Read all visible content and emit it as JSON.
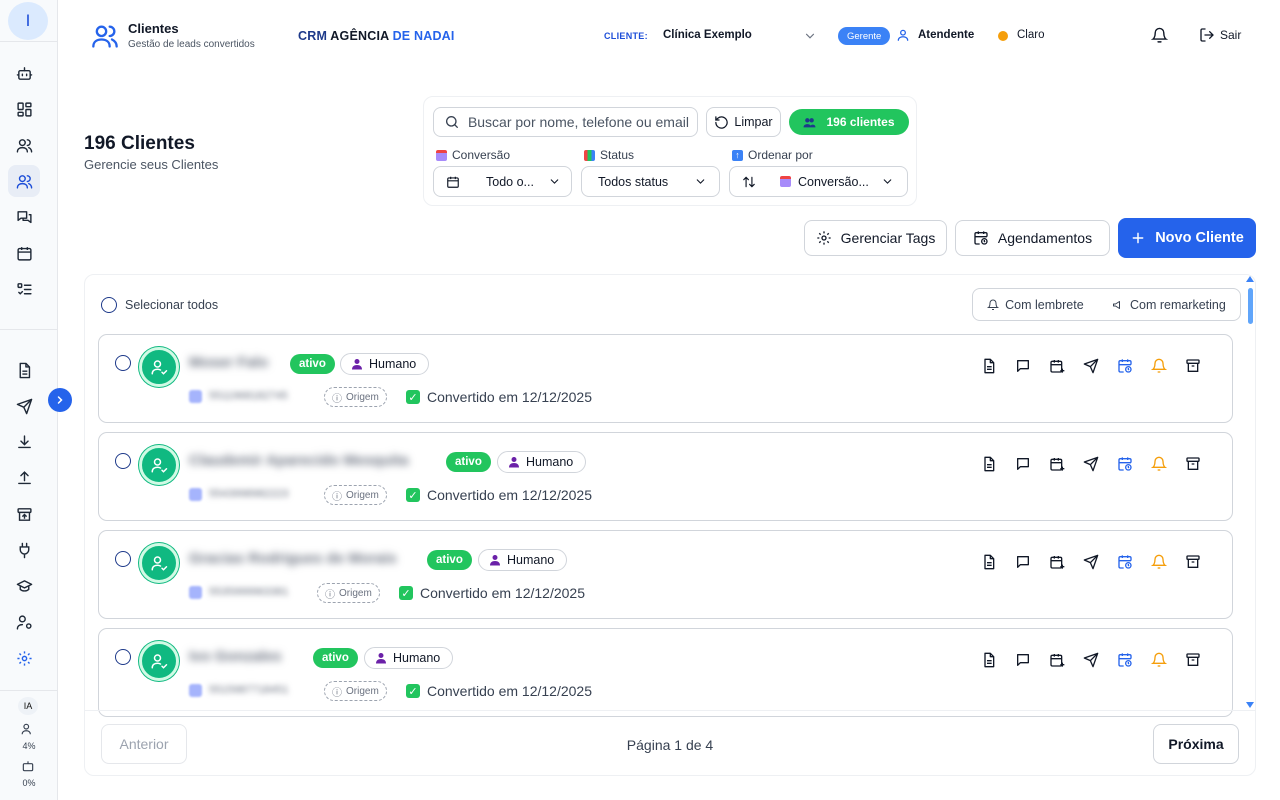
{
  "sidebar": {
    "avatar_letter": "I",
    "ia_label": "IA",
    "stat_users": "4%",
    "stat_bot": "0%"
  },
  "header": {
    "title": "Clientes",
    "subtitle": "Gestão de leads convertidos",
    "brand_part1": "CRM",
    "brand_part2": "AGÊNCIA",
    "brand_part3": "DE NADAI",
    "client_label": "CLIENTE:",
    "client_value": "Clínica Exemplo",
    "role_badge": "Gerente",
    "user_name": "Atendente",
    "theme_label": "Claro",
    "logout_label": "Sair"
  },
  "page": {
    "title": "196 Clientes",
    "subtitle": "Gerencie seus Clientes"
  },
  "filters": {
    "search_placeholder": "Buscar por nome, telefone ou email",
    "clear_label": "Limpar",
    "count_label": "196 clientes",
    "conversion_label": "Conversão",
    "conversion_value": "Todo o...",
    "status_label": "Status",
    "status_value": "Todos status",
    "order_label": "Ordenar por",
    "order_value": "Conversão..."
  },
  "actions": {
    "tags_label": "Gerenciar Tags",
    "schedules_label": "Agendamentos",
    "new_client_label": "Novo Cliente"
  },
  "list": {
    "select_all_label": "Selecionar todos",
    "with_reminder_label": "Com lembrete",
    "with_remarketing_label": "Com remarketing",
    "rows": [
      {
        "name": "Moser Falo",
        "phone": "5511968182745",
        "status": "ativo",
        "type": "Humano",
        "origin": "Origem",
        "converted": "Convertido em 12/12/2025"
      },
      {
        "name": "Claudemir Aparecido Mesquita",
        "phone": "5543998982223",
        "status": "ativo",
        "type": "Humano",
        "origin": "Origem",
        "converted": "Convertido em 12/12/2025"
      },
      {
        "name": "Gracias Rodrigues de Morais",
        "phone": "5535999963381",
        "status": "ativo",
        "type": "Humano",
        "origin": "Origem",
        "converted": "Convertido em 12/12/2025"
      },
      {
        "name": "Ivo Gonzales",
        "phone": "5515987718451",
        "status": "ativo",
        "type": "Humano",
        "origin": "Origem",
        "converted": "Convertido em 12/12/2025"
      }
    ]
  },
  "pagination": {
    "prev_label": "Anterior",
    "page_info": "Página 1 de 4",
    "next_label": "Próxima"
  },
  "colors": {
    "primary": "#2563eb",
    "success": "#22c55e",
    "accent_amber": "#f59e0b"
  }
}
